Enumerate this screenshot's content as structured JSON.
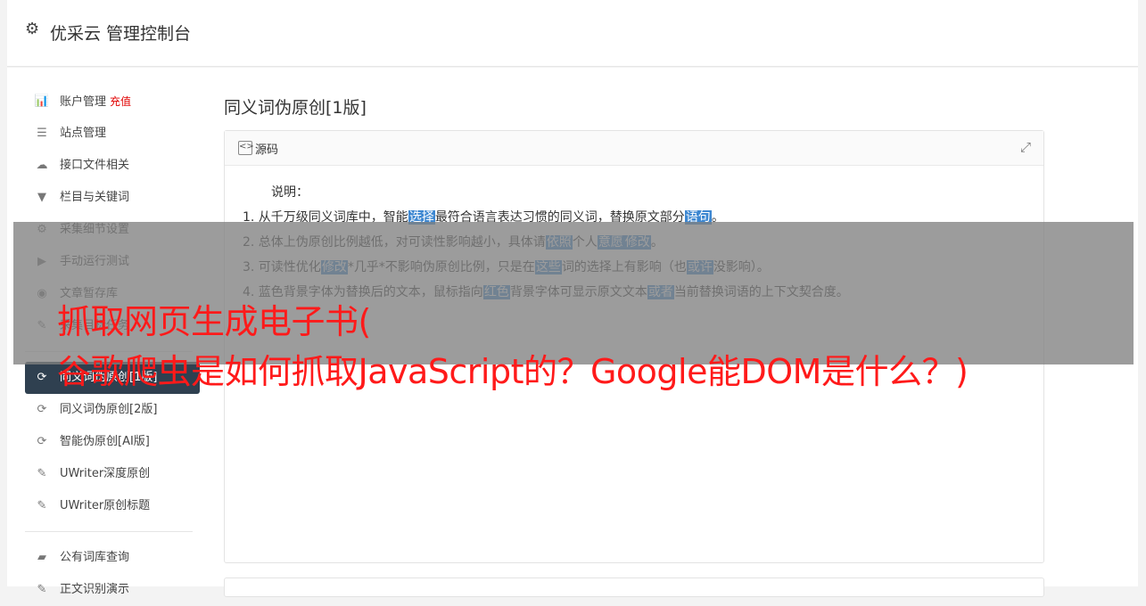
{
  "app": {
    "title": "优采云 管理控制台",
    "icon": "gear-icon"
  },
  "sidebar": {
    "group1": [
      {
        "label": "账户管理",
        "extra": "充值",
        "icon": "bar-chart-icon",
        "glyph": "📊"
      },
      {
        "label": "站点管理",
        "icon": "server-icon",
        "glyph": "☰"
      },
      {
        "label": "接口文件相关",
        "icon": "cloud-upload-icon",
        "glyph": "☁"
      },
      {
        "label": "栏目与关键词",
        "icon": "filter-icon",
        "glyph": "▼"
      },
      {
        "label": "采集细节设置",
        "icon": "cogs-icon",
        "glyph": "⚙"
      },
      {
        "label": "手动运行测试",
        "icon": "play-icon",
        "glyph": "▶"
      },
      {
        "label": "文章暂存库",
        "icon": "database-icon",
        "glyph": "◉"
      },
      {
        "label": "采集目标任务",
        "icon": "edit-icon",
        "glyph": "✎"
      }
    ],
    "group2": [
      {
        "label": "同义词伪原创[1版]",
        "icon": "refresh-icon",
        "glyph": "⟳",
        "active": true
      },
      {
        "label": "同义词伪原创[2版]",
        "icon": "refresh-icon",
        "glyph": "⟳"
      },
      {
        "label": "智能伪原创[AI版]",
        "icon": "refresh-icon",
        "glyph": "⟳"
      },
      {
        "label": "UWriter深度原创",
        "icon": "edit-icon",
        "glyph": "✎"
      },
      {
        "label": "UWriter原创标题",
        "icon": "edit-icon",
        "glyph": "✎"
      }
    ],
    "group3": [
      {
        "label": "公有词库查询",
        "icon": "book-icon",
        "glyph": "▰"
      },
      {
        "label": "正文识别演示",
        "icon": "edit-icon",
        "glyph": "✎"
      }
    ]
  },
  "main": {
    "title": "同义词伪原创[1版]",
    "card": {
      "header_label": "源码",
      "note_heading": "说明：",
      "lines": [
        [
          "1. 从千万级同义词库中，智能",
          {
            "hl": "选择"
          },
          "最符合语言表达习惯的同义词，替换原文部分",
          {
            "hl": "语句"
          },
          "。"
        ],
        [
          "2. 总体上伪原创比例越低，对可读性影响越小，具体请",
          {
            "hl": "依照"
          },
          "个人",
          {
            "hl": "意愿"
          },
          {
            "hl": "修改"
          },
          "。"
        ],
        [
          "3. 可读性优化",
          {
            "hl": "修改"
          },
          "*几乎*不影响伪原创比例，只是在",
          {
            "hl": "这些"
          },
          "词的选择上有影响（也",
          {
            "hl": "或许"
          },
          "没影响）。"
        ],
        [
          "4. 蓝色背景字体为替换后的文本，鼠标指向",
          {
            "hl": "红色"
          },
          "背景字体可显示原文文本",
          {
            "hl": "或者"
          },
          "当前替换词语的上下文契合度。"
        ]
      ]
    }
  },
  "overlay": {
    "line1": "抓取网页生成电子书(",
    "line2": "谷歌爬虫是如何抓取JavaScript的？Google能DOM是什么？)"
  }
}
